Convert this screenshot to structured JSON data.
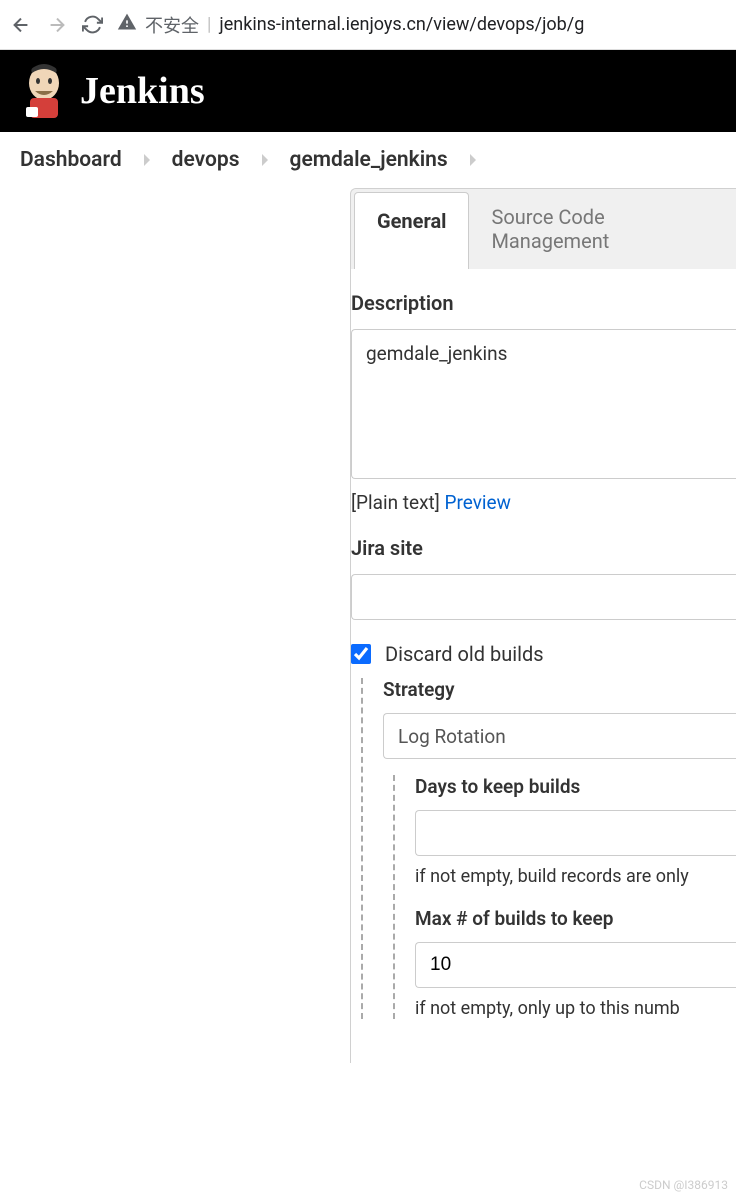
{
  "browser": {
    "insecure_label": "不安全",
    "url": "jenkins-internal.ienjoys.cn/view/devops/job/g"
  },
  "header": {
    "title": "Jenkins"
  },
  "breadcrumb": {
    "items": [
      "Dashboard",
      "devops",
      "gemdale_jenkins"
    ]
  },
  "tabs": {
    "general": "General",
    "scm": "Source Code Management"
  },
  "form": {
    "description_label": "Description",
    "description_value": "gemdale_jenkins",
    "plain_text": "[Plain text]",
    "preview": "Preview",
    "jira_label": "Jira site",
    "jira_value": "",
    "discard_label": "Discard old builds",
    "strategy_label": "Strategy",
    "strategy_value": "Log Rotation",
    "days_label": "Days to keep builds",
    "days_value": "",
    "days_help": "if not empty, build records are only",
    "max_label": "Max # of builds to keep",
    "max_value": "10",
    "max_help": "if not empty, only up to this numb"
  },
  "watermark": "CSDN @I386913"
}
